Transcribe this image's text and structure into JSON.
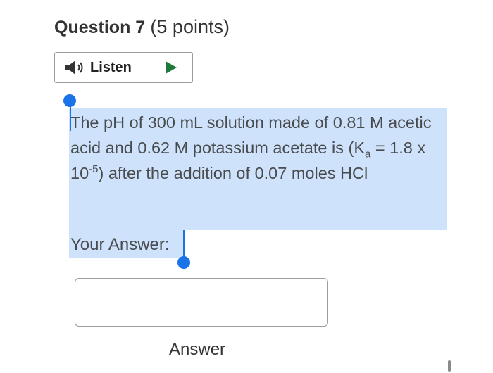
{
  "question": {
    "title": "Question 7",
    "points": "(5 points)"
  },
  "listen": {
    "label": "Listen",
    "speaker_icon": "speaker-icon",
    "play_icon": "play-icon",
    "play_color": "#1e7a3c"
  },
  "question_text": {
    "line1": "The pH of 300 mL solution made of 0.81 M acetic acid and 0.62 M potassium acetate is (K",
    "ka_sub": "a",
    "mid": " = 1.8 x 10",
    "exp": "-5",
    "end": ") after the addition of 0.07 moles HCl"
  },
  "answer_label": "Your Answer:",
  "answer_input": {
    "value": "",
    "placeholder": ""
  },
  "answer_caption": "Answer",
  "colors": {
    "selection": "#cfe2fb",
    "handle": "#1a73e8"
  }
}
